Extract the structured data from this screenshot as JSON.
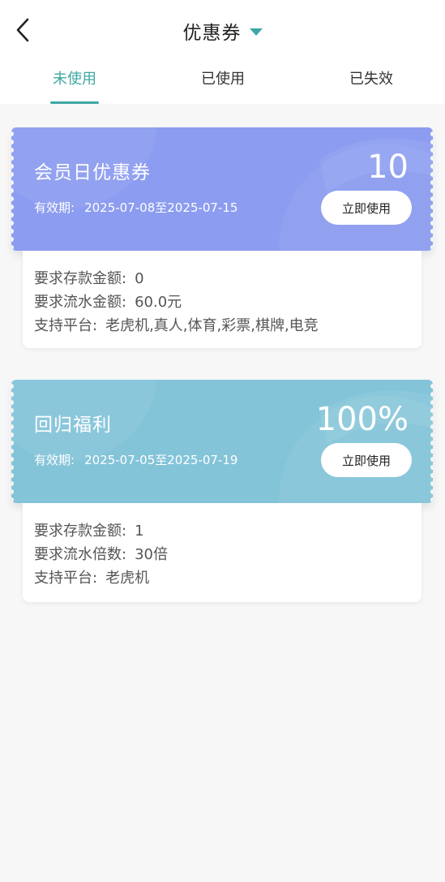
{
  "header": {
    "title": "优惠券",
    "back_icon": "chevron-left-icon",
    "title_caret_icon": "caret-down-icon",
    "accent_color": "#3ea7a4"
  },
  "tabs": [
    {
      "label": "未使用",
      "active": true
    },
    {
      "label": "已使用",
      "active": false
    },
    {
      "label": "已失效",
      "active": false
    }
  ],
  "coupons": [
    {
      "name": "会员日优惠券",
      "value": "10",
      "validity_label": "有效期:",
      "validity": "2025-07-08至2025-07-15",
      "button": "立即使用",
      "color": "#8c9cf0",
      "details": [
        {
          "label": "要求存款金额:",
          "value": "0"
        },
        {
          "label": "要求流水金额:",
          "value": "60.0元"
        },
        {
          "label": "支持平台:",
          "value": "老虎机,真人,体育,彩票,棋牌,电竞"
        }
      ]
    },
    {
      "name": "回归福利",
      "value": "100%",
      "validity_label": "有效期:",
      "validity": "2025-07-05至2025-07-19",
      "button": "立即使用",
      "color": "#84c4d9",
      "details": [
        {
          "label": "要求存款金额:",
          "value": "1"
        },
        {
          "label": "要求流水倍数:",
          "value": "30倍"
        },
        {
          "label": "支持平台:",
          "value": "老虎机"
        }
      ]
    }
  ]
}
